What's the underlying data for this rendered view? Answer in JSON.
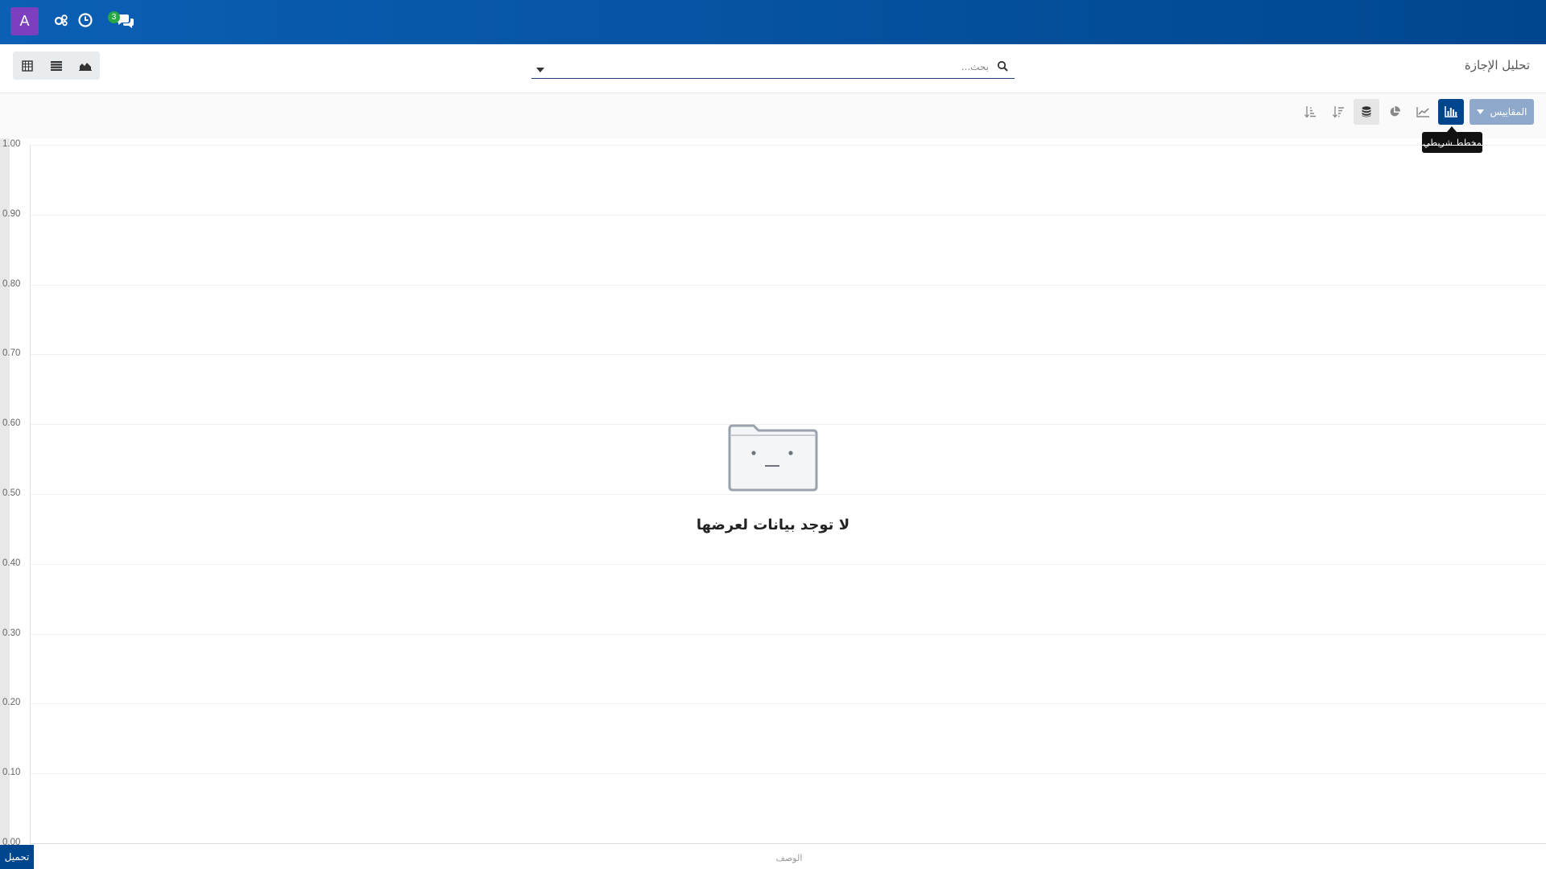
{
  "navbar": {
    "avatar_letter": "A",
    "messages_badge": "3",
    "accent": "#00468e"
  },
  "control_panel": {
    "title": "تحليل الإجازة",
    "search": {
      "placeholder": "بحث..."
    },
    "views": [
      "pivot",
      "list",
      "graph"
    ]
  },
  "toolbar": {
    "measures_label": "المقاييس",
    "chart_types": [
      "bar",
      "line",
      "pie"
    ],
    "active_chart": "bar",
    "tooltip": "مخطط شريطي"
  },
  "chart_data": {
    "type": "bar",
    "categories": [],
    "values": [],
    "xlabel": "الوصف",
    "ylim": [
      0,
      1
    ],
    "yticks": [
      "1.00",
      "0.90",
      "0.80",
      "0.70",
      "0.60",
      "0.50",
      "0.40",
      "0.30",
      "0.20",
      "0.10",
      "0.00"
    ],
    "empty_message": "لا توجد بيانات لعرضها"
  },
  "footer": {
    "download_label": "تحميل"
  }
}
